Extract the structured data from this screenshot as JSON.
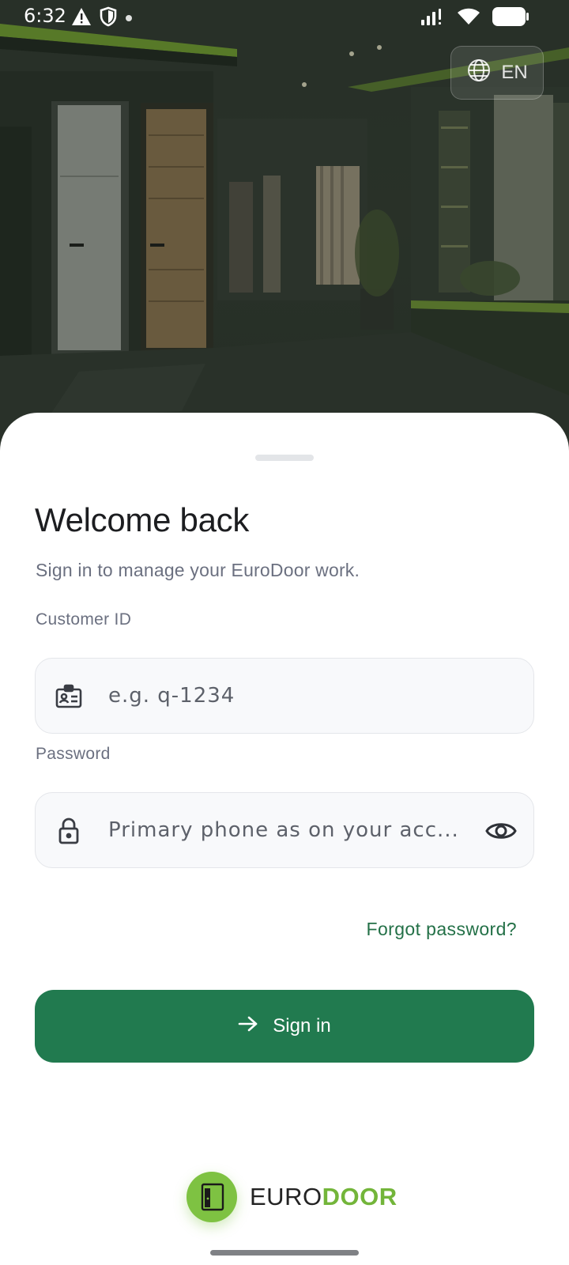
{
  "status_bar": {
    "time": "6:32",
    "left_icons": [
      "warning-icon",
      "shield-icon",
      "dot-icon"
    ],
    "right_icons": [
      "signal-icon",
      "wifi-icon",
      "battery-icon"
    ]
  },
  "language": {
    "code": "EN",
    "icon": "globe-icon"
  },
  "login": {
    "title": "Welcome back",
    "subtitle": "Sign in to manage your EuroDoor work.",
    "customer_id": {
      "label": "Customer ID",
      "placeholder": "e.g. q-1234",
      "value": "",
      "icon": "id-card-icon"
    },
    "password": {
      "label": "Password",
      "placeholder": "Primary phone as on your acc...",
      "value": "",
      "icon": "lock-icon",
      "toggle_icon": "eye-icon"
    },
    "forgot_label": "Forgot password?",
    "signin_label": "Sign in",
    "signin_icon": "arrow-right-icon"
  },
  "brand": {
    "name_part1": "EURO",
    "name_part2": "DOOR",
    "logo_icon": "door-logo-icon"
  },
  "colors": {
    "accent": "#217a4f",
    "brand_green": "#7ec242",
    "link": "#237047"
  }
}
